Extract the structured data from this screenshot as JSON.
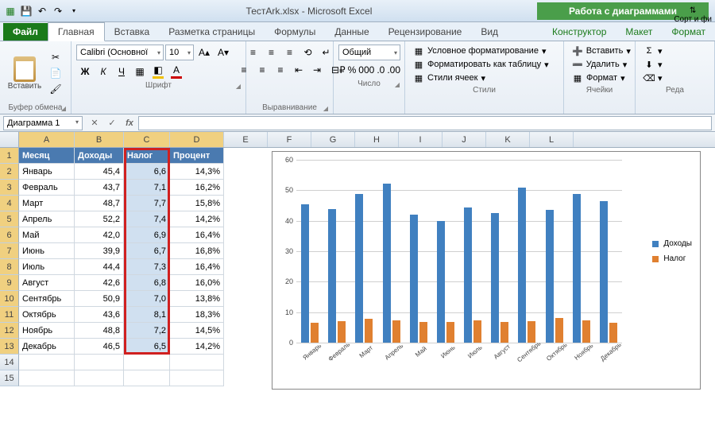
{
  "titlebar": {
    "filename": "ТестArk.xlsx",
    "app": "Microsoft Excel",
    "chart_tools": "Работа с диаграммами"
  },
  "tabs": {
    "file": "Файл",
    "home": "Главная",
    "insert": "Вставка",
    "layout": "Разметка страницы",
    "formulas": "Формулы",
    "data": "Данные",
    "review": "Рецензирование",
    "view": "Вид",
    "design": "Конструктор",
    "chart_layout": "Макет",
    "format": "Формат"
  },
  "ribbon": {
    "clipboard": {
      "paste": "Вставить",
      "label": "Буфер обмена"
    },
    "font": {
      "name": "Calibri (Основної",
      "size": "10",
      "label": "Шрифт"
    },
    "alignment": {
      "label": "Выравнивание"
    },
    "number": {
      "format": "Общий",
      "label": "Число"
    },
    "styles": {
      "cond": "Условное форматирование",
      "table": "Форматировать как таблицу",
      "cell": "Стили ячеек",
      "label": "Стили"
    },
    "cells": {
      "insert": "Вставить",
      "delete": "Удалить",
      "format": "Формат",
      "label": "Ячейки"
    },
    "editing": {
      "sort": "Сорт и фи",
      "label": "Реда"
    }
  },
  "formula_bar": {
    "name_box": "Диаграмма 1"
  },
  "columns": [
    "A",
    "B",
    "C",
    "D",
    "E",
    "F",
    "G",
    "H",
    "I",
    "J",
    "K",
    "L"
  ],
  "headers": {
    "A": "Месяц",
    "B": "Доходы",
    "C": "Налог",
    "D": "Процент"
  },
  "rows": [
    {
      "m": "Январь",
      "inc": "45,4",
      "tax": "6,6",
      "pct": "14,3%"
    },
    {
      "m": "Февраль",
      "inc": "43,7",
      "tax": "7,1",
      "pct": "16,2%"
    },
    {
      "m": "Март",
      "inc": "48,7",
      "tax": "7,7",
      "pct": "15,8%"
    },
    {
      "m": "Апрель",
      "inc": "52,2",
      "tax": "7,4",
      "pct": "14,2%"
    },
    {
      "m": "Май",
      "inc": "42,0",
      "tax": "6,9",
      "pct": "16,4%"
    },
    {
      "m": "Июнь",
      "inc": "39,9",
      "tax": "6,7",
      "pct": "16,8%"
    },
    {
      "m": "Июль",
      "inc": "44,4",
      "tax": "7,3",
      "pct": "16,4%"
    },
    {
      "m": "Август",
      "inc": "42,6",
      "tax": "6,8",
      "pct": "16,0%"
    },
    {
      "m": "Сентябрь",
      "inc": "50,9",
      "tax": "7,0",
      "pct": "13,8%"
    },
    {
      "m": "Октябрь",
      "inc": "43,6",
      "tax": "8,1",
      "pct": "18,3%"
    },
    {
      "m": "Ноябрь",
      "inc": "48,8",
      "tax": "7,2",
      "pct": "14,5%"
    },
    {
      "m": "Декабрь",
      "inc": "46,5",
      "tax": "6,5",
      "pct": "14,2%"
    }
  ],
  "chart_data": {
    "type": "bar",
    "categories": [
      "Январь",
      "Февраль",
      "Март",
      "Апрель",
      "Май",
      "Июнь",
      "Июль",
      "Август",
      "Сентябрь",
      "Октябрь",
      "Ноябрь",
      "Декабрь"
    ],
    "series": [
      {
        "name": "Доходы",
        "values": [
          45.4,
          43.7,
          48.7,
          52.2,
          42.0,
          39.9,
          44.4,
          42.6,
          50.9,
          43.6,
          48.8,
          46.5
        ],
        "color": "#4080c0"
      },
      {
        "name": "Налог",
        "values": [
          6.6,
          7.1,
          7.7,
          7.4,
          6.9,
          6.7,
          7.3,
          6.8,
          7.0,
          8.1,
          7.2,
          6.5
        ],
        "color": "#e08030"
      }
    ],
    "ylim": [
      0,
      60
    ],
    "yticks": [
      0,
      10,
      20,
      30,
      40,
      50,
      60
    ]
  }
}
